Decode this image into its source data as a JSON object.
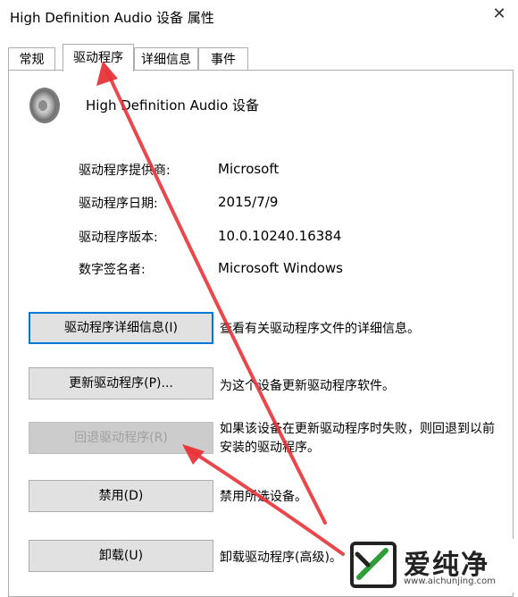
{
  "window": {
    "title": "High Definition Audio 设备 属性",
    "close_symbol": "✕"
  },
  "tabs": [
    {
      "label": "常规"
    },
    {
      "label": "驱动程序",
      "active": true
    },
    {
      "label": "详细信息"
    },
    {
      "label": "事件"
    }
  ],
  "device": {
    "name": "High Definition Audio 设备",
    "icon": "speaker-icon"
  },
  "info": [
    {
      "label": "驱动程序提供商:",
      "value": "Microsoft"
    },
    {
      "label": "驱动程序日期:",
      "value": "2015/7/9"
    },
    {
      "label": "驱动程序版本:",
      "value": "10.0.10240.16384"
    },
    {
      "label": "数字签名者:",
      "value": "Microsoft Windows"
    }
  ],
  "actions": [
    {
      "button": "驱动程序详细信息(I)",
      "desc": "查看有关驱动程序文件的详细信息。"
    },
    {
      "button": "更新驱动程序(P)...",
      "desc": "为这个设备更新驱动程序软件。"
    },
    {
      "button": "回退驱动程序(R)",
      "desc": "如果该设备在更新驱动程序时失败，则回退到以前安装的驱动程序。",
      "disabled": true
    },
    {
      "button": "禁用(D)",
      "desc": "禁用所选设备。"
    },
    {
      "button": "卸载(U)",
      "desc": "卸载驱动程序(高级)。"
    }
  ],
  "watermark": {
    "text": "爱纯净",
    "url": "www.aichunjing.com"
  },
  "colors": {
    "focus": "#0078d7",
    "annotation": "#e8343a",
    "button_bg": "#e1e1e1"
  }
}
